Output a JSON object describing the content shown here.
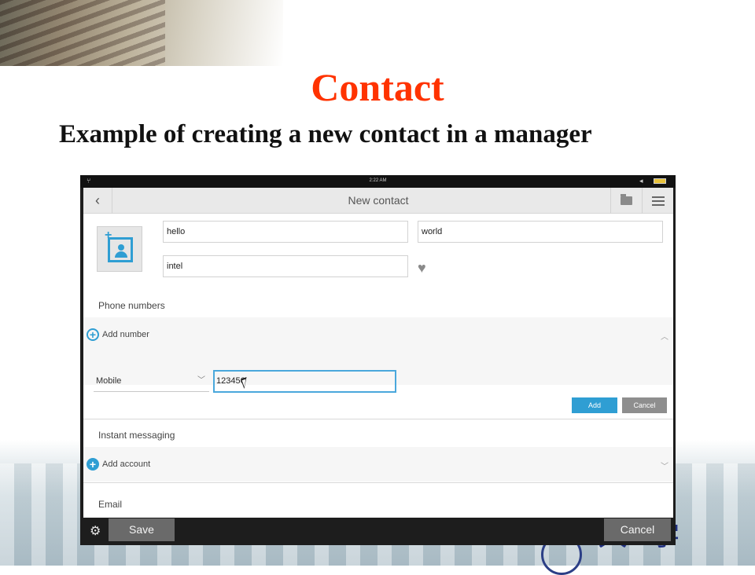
{
  "slide": {
    "title": "Contact",
    "subtitle": "Example of creating a new contact in a manager"
  },
  "status_bar": {
    "time": "2:22 AM"
  },
  "app_bar": {
    "title": "New contact",
    "back_icon": "chevron-left-icon",
    "folder_icon": "folder-icon",
    "menu_icon": "list-menu-icon"
  },
  "contact": {
    "first_name": "hello",
    "last_name": "world",
    "company": "intel",
    "photo_icon": "add-contact-photo-icon",
    "favorite_icon": "heart-icon"
  },
  "phone": {
    "section_label": "Phone numbers",
    "add_label": "Add number",
    "type_value": "Mobile",
    "number_value": "123456",
    "add_button": "Add",
    "cancel_button": "Cancel"
  },
  "im": {
    "section_label": "Instant messaging",
    "add_label": "Add account"
  },
  "email": {
    "section_label": "Email"
  },
  "bottom_bar": {
    "save_label": "Save",
    "cancel_label": "Cancel",
    "settings_icon": "gear-icon"
  },
  "colors": {
    "title_red": "#ff3300",
    "accent_blue": "#2f9ed3",
    "bar_dark": "#1d1d1d"
  }
}
